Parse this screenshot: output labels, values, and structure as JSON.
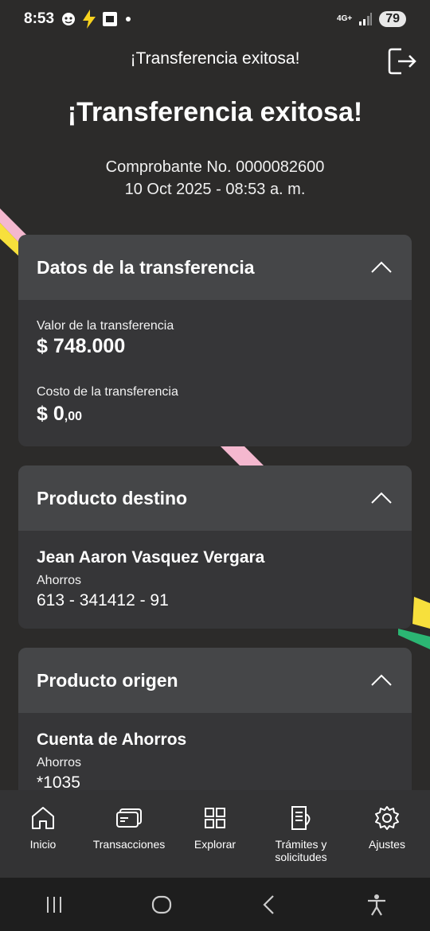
{
  "status_bar": {
    "time": "8:53",
    "network": "4G+",
    "battery": "79"
  },
  "header": {
    "title": "¡Transferencia exitosa!"
  },
  "hero": {
    "title": "¡Transferencia exitosa!",
    "receipt": "Comprobante No. 0000082600",
    "datetime": "10 Oct 2025 - 08:53 a. m."
  },
  "transfer_card": {
    "title": "Datos de la transferencia",
    "value_label": "Valor de la transferencia",
    "value": "$ 748.000",
    "cost_label": "Costo de la transferencia",
    "cost_main": "$ 0",
    "cost_decimals": ",00"
  },
  "destination_card": {
    "title": "Producto destino",
    "holder": "Jean Aaron Vasquez Vergara",
    "account_type": "Ahorros",
    "account_number": "613 - 341412 - 91"
  },
  "origin_card": {
    "title": "Producto origen",
    "product": "Cuenta de Ahorros",
    "account_type": "Ahorros",
    "account_number": "*1035"
  },
  "bottom_nav": {
    "home": "Inicio",
    "transactions": "Transacciones",
    "explore": "Explorar",
    "procedures": "Trámites y solicitudes",
    "settings": "Ajustes"
  },
  "colors": {
    "background": "#2c2b2a",
    "card": "#363638",
    "card_header": "#454648",
    "accent_yellow": "#f7e03c",
    "accent_pink": "#f4b8cf",
    "accent_green": "#2bb673"
  }
}
